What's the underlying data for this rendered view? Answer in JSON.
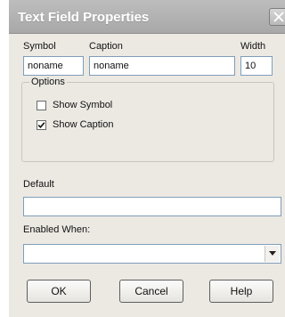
{
  "dialog": {
    "title": "Text Field Properties",
    "labels": {
      "symbol": "Symbol",
      "caption": "Caption",
      "width": "Width",
      "options": "Options",
      "default": "Default",
      "enabled_when": "Enabled When:"
    },
    "fields": {
      "symbol_value": "noname",
      "caption_value": "noname",
      "width_value": "10",
      "default_value": "",
      "enabled_when_value": ""
    },
    "options": {
      "show_symbol": {
        "label": "Show Symbol",
        "checked": false
      },
      "show_caption": {
        "label": "Show Caption",
        "checked": true
      }
    },
    "buttons": {
      "ok": "OK",
      "cancel": "Cancel",
      "help": "Help"
    },
    "icons": {
      "close": "close-icon",
      "dropdown": "chevron-down-icon",
      "check": "checkmark-icon"
    }
  }
}
